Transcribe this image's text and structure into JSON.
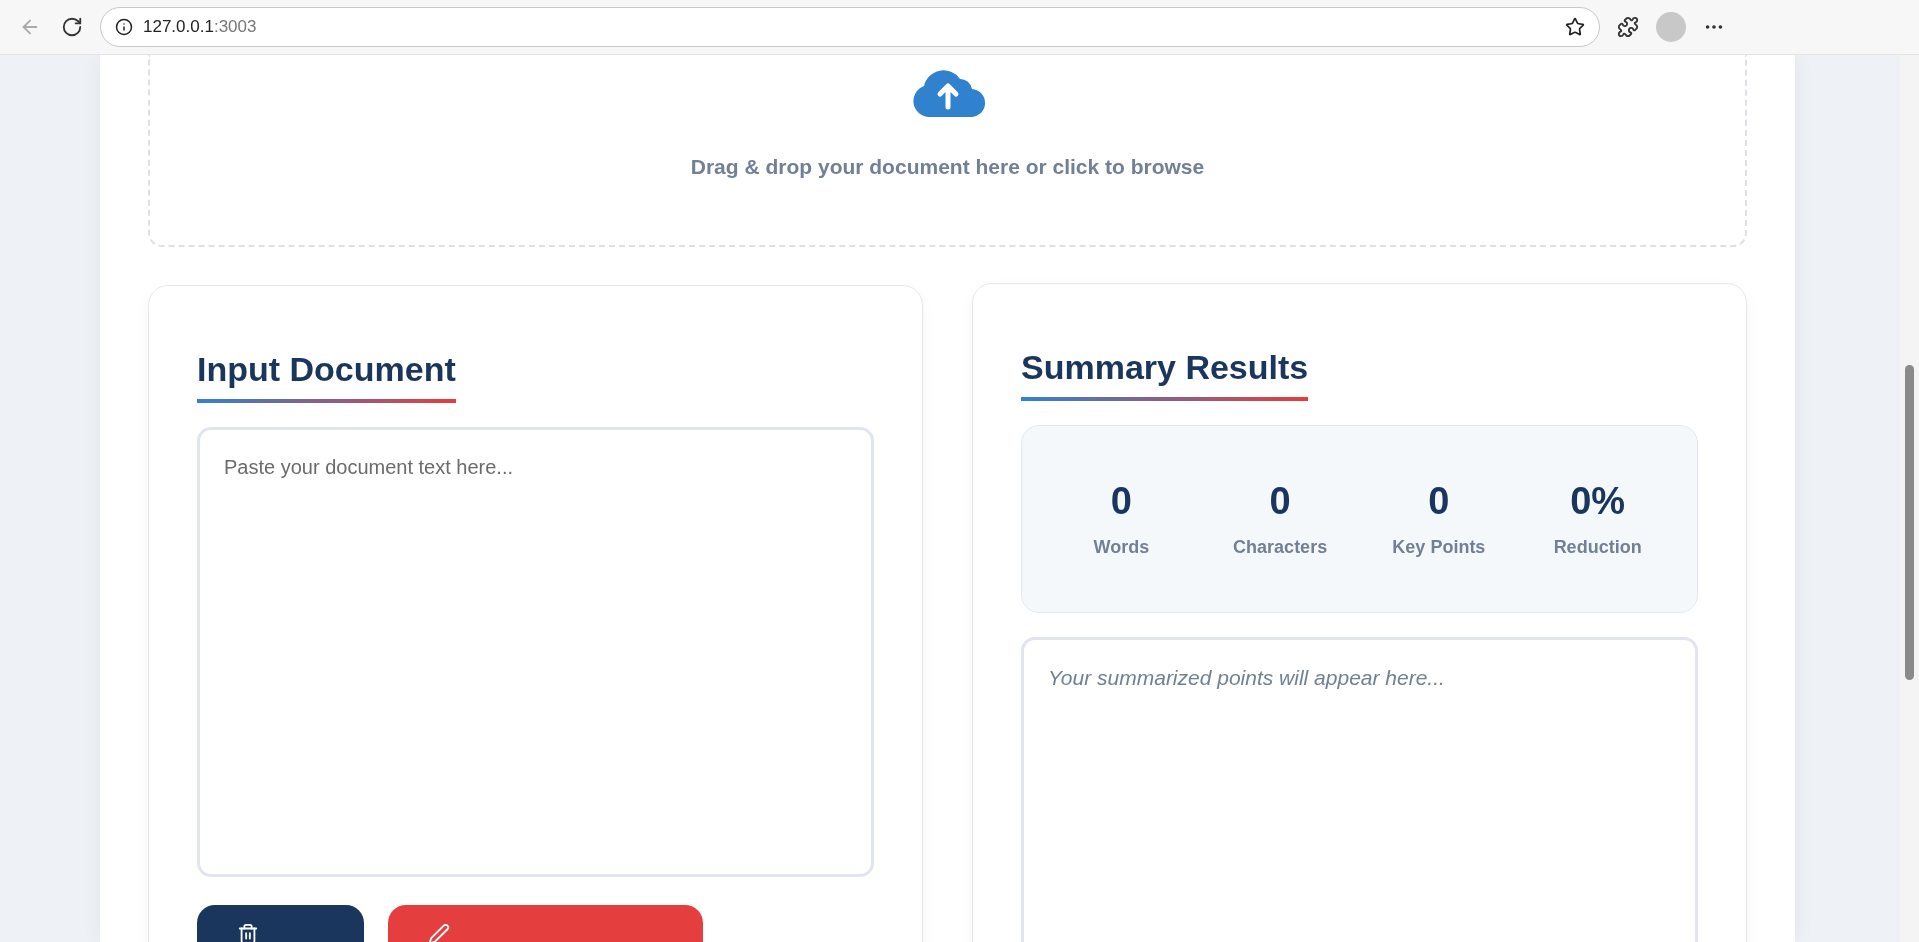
{
  "browser": {
    "url_host": "127.0.0.1",
    "url_port": ":3003"
  },
  "dropzone": {
    "text": "Drag & drop your document here or click to browse"
  },
  "input_panel": {
    "title": "Input Document",
    "textarea": {
      "placeholder": "Paste your document text here..."
    },
    "buttons": [
      {
        "kind": "clear"
      },
      {
        "kind": "summarize"
      }
    ]
  },
  "summary_panel": {
    "title": "Summary Results",
    "stats": [
      {
        "value": "0",
        "label": "Words"
      },
      {
        "value": "0",
        "label": "Characters"
      },
      {
        "value": "0",
        "label": "Key Points"
      },
      {
        "value": "0%",
        "label": "Reduction"
      }
    ],
    "output_placeholder": "Your summarized points will appear here..."
  }
}
